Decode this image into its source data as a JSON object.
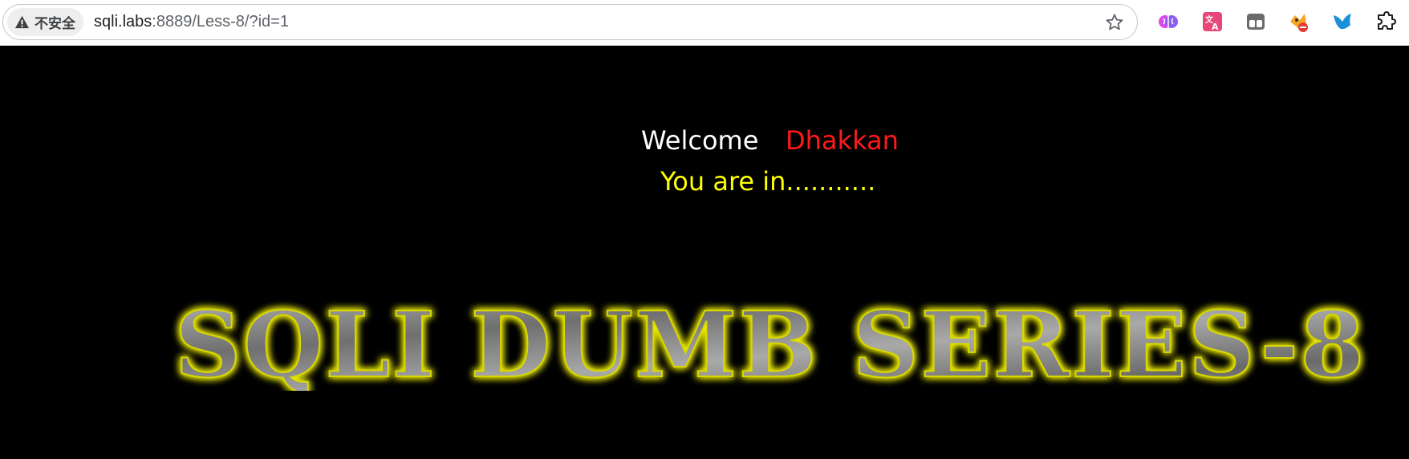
{
  "browser": {
    "security_label": "不安全",
    "url_host": "sqli.labs",
    "url_rest": ":8889/Less-8/?id=1",
    "icons": [
      "warning-icon",
      "bookmark-star-icon",
      "brain-extension-icon",
      "translate-extension-icon",
      "tabs-extension-icon",
      "blocked-extension-icon",
      "bird-extension-icon",
      "extensions-puzzle-icon"
    ]
  },
  "page": {
    "welcome": "Welcome",
    "user_name": "Dhakkan",
    "status": "You are in...........",
    "banner_text": "SQLI DUMB SERIES-8"
  },
  "colors": {
    "background": "#000000",
    "welcome": "#ffffff",
    "user_name": "#ff1a1a",
    "status": "#ffff00",
    "banner_glow": "#f5f500",
    "banner_fill": "#8a8a8a"
  }
}
